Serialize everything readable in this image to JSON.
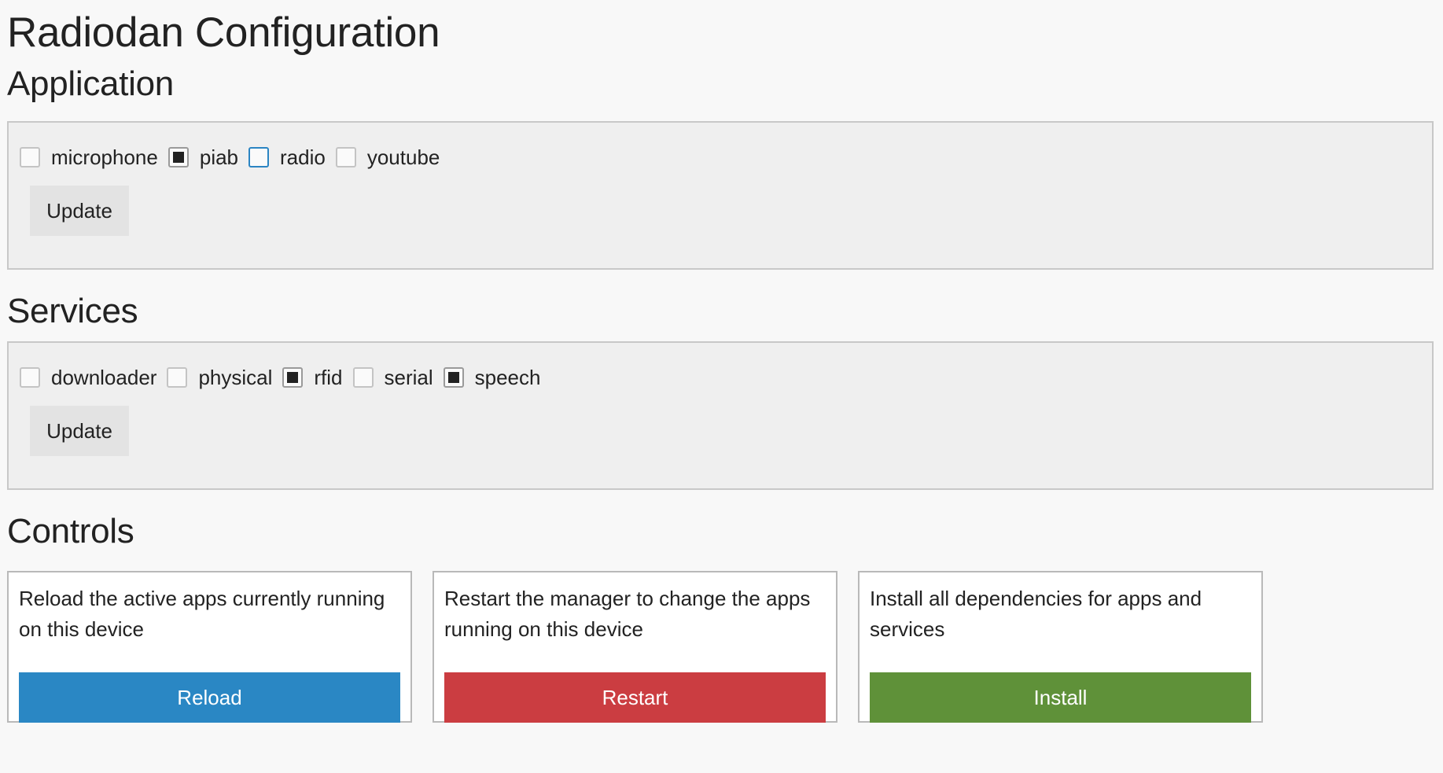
{
  "title": "Radiodan Configuration",
  "application": {
    "heading": "Application",
    "items": [
      {
        "label": "microphone",
        "checked": false,
        "focused": false
      },
      {
        "label": "piab",
        "checked": true,
        "focused": false
      },
      {
        "label": "radio",
        "checked": false,
        "focused": true
      },
      {
        "label": "youtube",
        "checked": false,
        "focused": false
      }
    ],
    "update_label": "Update"
  },
  "services": {
    "heading": "Services",
    "items": [
      {
        "label": "downloader",
        "checked": false,
        "focused": false
      },
      {
        "label": "physical",
        "checked": false,
        "focused": false
      },
      {
        "label": "rfid",
        "checked": true,
        "focused": false
      },
      {
        "label": "serial",
        "checked": false,
        "focused": false
      },
      {
        "label": "speech",
        "checked": true,
        "focused": false
      }
    ],
    "update_label": "Update"
  },
  "controls": {
    "heading": "Controls",
    "cards": [
      {
        "text": "Reload the active apps currently running on this device",
        "button": "Reload",
        "color": "#2a87c4"
      },
      {
        "text": "Restart the manager to change the apps running on this device",
        "button": "Restart",
        "color": "#cb3d41"
      },
      {
        "text": "Install all dependencies for apps and services",
        "button": "Install",
        "color": "#5f9139"
      }
    ]
  }
}
